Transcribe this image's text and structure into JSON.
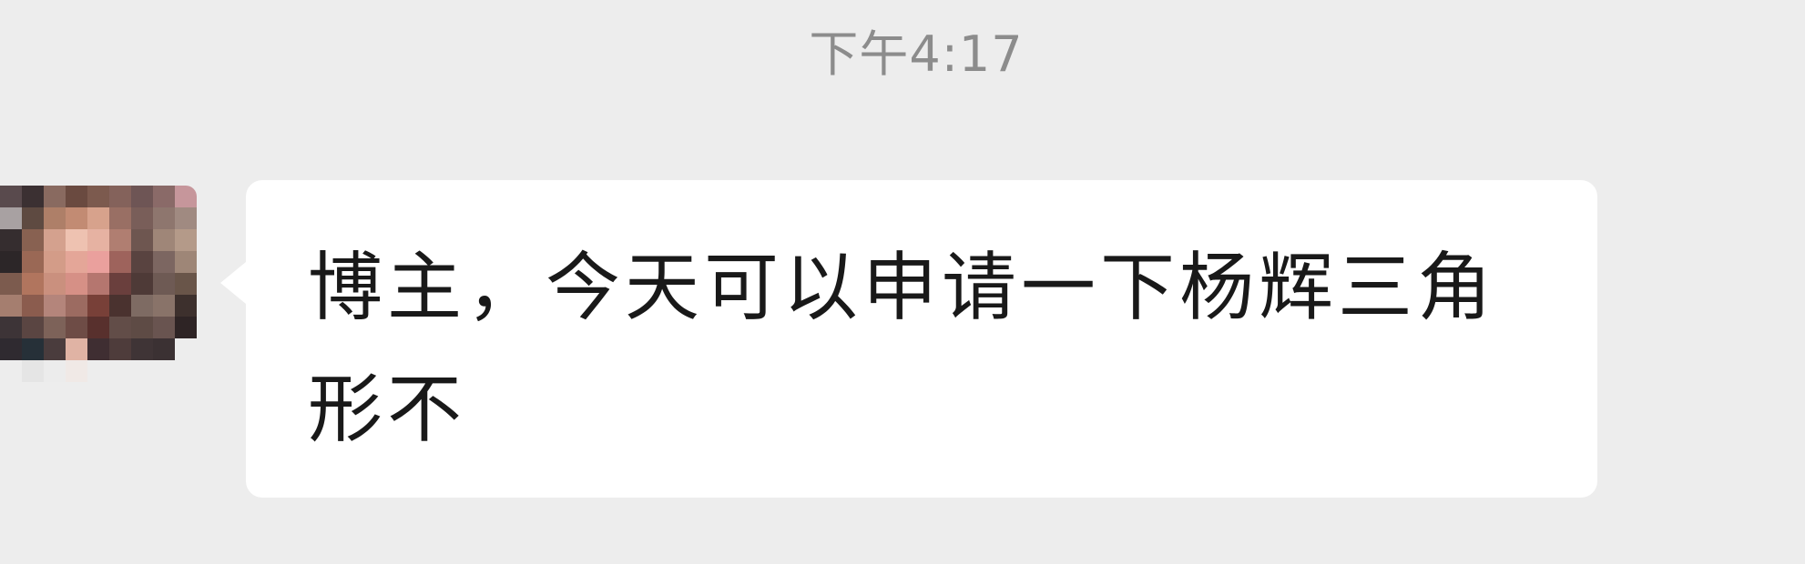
{
  "chat": {
    "timestamp": "下午4:17",
    "message": {
      "text": "博主，今天可以申请一下杨辉三角形不",
      "avatar_icon": "pixelated-avatar-icon"
    }
  },
  "colors": {
    "background": "#ededed",
    "bubble": "#ffffff",
    "timestamp_text": "#8c8c8c",
    "message_text": "#191919"
  }
}
